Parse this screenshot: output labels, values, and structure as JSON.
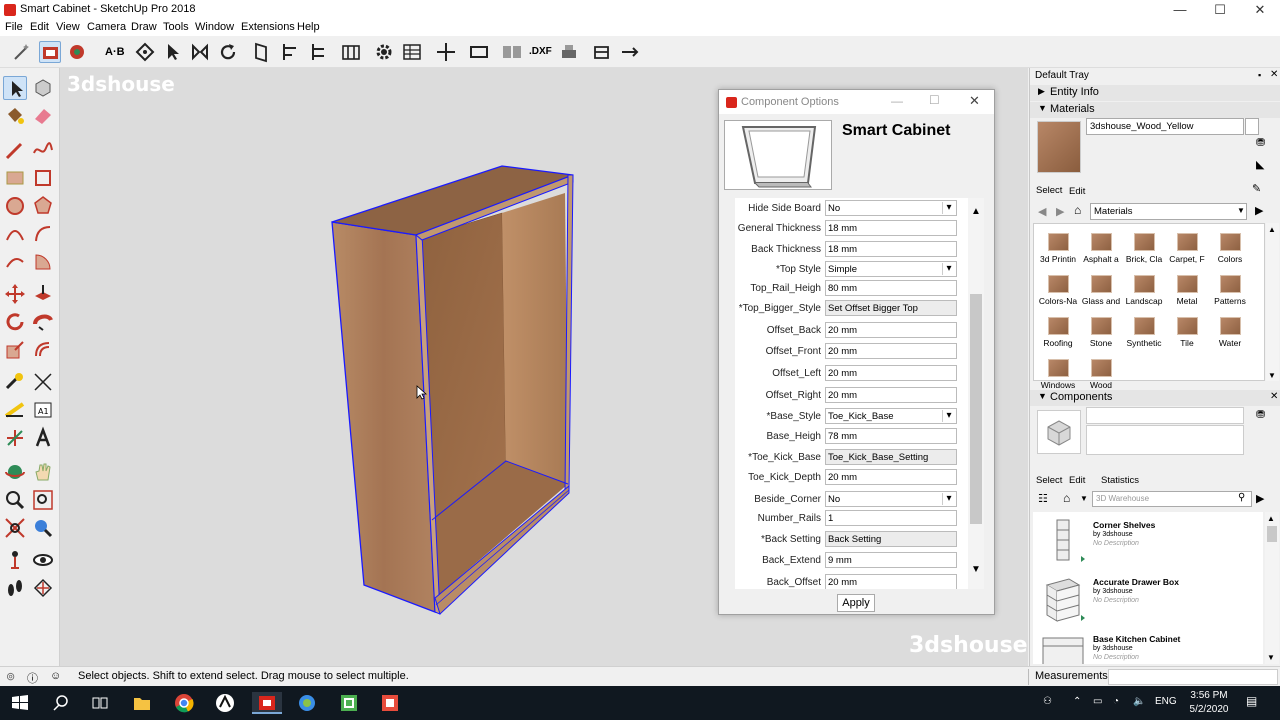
{
  "window": {
    "title": "Smart Cabinet - SketchUp Pro 2018",
    "min": "—",
    "max": "☐",
    "close": "✕"
  },
  "menu": [
    "File",
    "Edit",
    "View",
    "Camera",
    "Draw",
    "Tools",
    "Window",
    "Extensions",
    "Help"
  ],
  "watermark": "3dshouse",
  "component_options": {
    "dialog_title": "Component Options",
    "component_name": "Smart Cabinet",
    "rows": [
      {
        "label": "Hide Side Board",
        "value": "No",
        "kind": "select"
      },
      {
        "label": "General Thickness",
        "value": "18 mm",
        "kind": "input"
      },
      {
        "label": "Back Thickness",
        "value": "18 mm",
        "kind": "input"
      },
      {
        "label": "*Top Style",
        "value": "Simple",
        "kind": "select"
      },
      {
        "label": "Top_Rail_Heigh",
        "value": "80 mm",
        "kind": "input"
      },
      {
        "label": "*Top_Bigger_Style",
        "value": "Set Offset Bigger Top",
        "kind": "button"
      },
      {
        "label": "Offset_Back",
        "value": "20 mm",
        "kind": "input"
      },
      {
        "label": "Offset_Front",
        "value": "20 mm",
        "kind": "input"
      },
      {
        "label": "Offset_Left",
        "value": "20 mm",
        "kind": "input"
      },
      {
        "label": "Offset_Right",
        "value": "20 mm",
        "kind": "input"
      },
      {
        "label": "*Base_Style",
        "value": "Toe_Kick_Base",
        "kind": "select"
      },
      {
        "label": "Base_Heigh",
        "value": "78 mm",
        "kind": "input"
      },
      {
        "label": "*Toe_Kick_Base",
        "value": "Toe_Kick_Base_Setting",
        "kind": "button"
      },
      {
        "label": "Toe_Kick_Depth",
        "value": "20 mm",
        "kind": "input"
      },
      {
        "label": "Beside_Corner",
        "value": "No",
        "kind": "select"
      },
      {
        "label": "Number_Rails",
        "value": "1",
        "kind": "input"
      },
      {
        "label": "*Back Setting",
        "value": "Back Setting",
        "kind": "button"
      },
      {
        "label": "Back_Extend",
        "value": "9 mm",
        "kind": "input"
      },
      {
        "label": "Back_Offset",
        "value": "20 mm",
        "kind": "input"
      }
    ],
    "apply_label": "Apply"
  },
  "tray": {
    "title": "Default Tray",
    "entity_info": "Entity Info",
    "materials": {
      "header": "Materials",
      "current_name": "3dshouse_Wood_Yellow",
      "tab_select": "Select",
      "tab_edit": "Edit",
      "library": "Materials",
      "items": [
        "3d Printin",
        "Asphalt a",
        "Brick, Cla",
        "Carpet, F",
        "Colors",
        "Colors-Na",
        "Glass and",
        "Landscap",
        "Metal",
        "Patterns",
        "Roofing",
        "Stone",
        "Synthetic",
        "Tile",
        "Water",
        "Windows",
        "Wood"
      ]
    },
    "components": {
      "header": "Components",
      "tab_select": "Select",
      "tab_edit": "Edit",
      "tab_statistics": "Statistics",
      "search_placeholder": "3D Warehouse",
      "items": [
        {
          "title": "Corner Shelves",
          "by": "by 3dshouse",
          "desc": "No Description"
        },
        {
          "title": "Accurate  Drawer Box",
          "by": "by 3dshouse",
          "desc": "No Description"
        },
        {
          "title": "Base Kitchen Cabinet",
          "by": "by 3dshouse",
          "desc": "No Description"
        }
      ]
    }
  },
  "status": {
    "message": "Select objects. Shift to extend select. Drag mouse to select multiple.",
    "measurements": "Measurements"
  },
  "taskbar": {
    "time": "3:56 PM",
    "date": "5/2/2020",
    "lang": "ENG"
  },
  "colors": {
    "viewport": "#dcdcdc",
    "wood": "#a97a55",
    "selection": "#1a1aff",
    "sketchup_red": "#d9261c"
  }
}
